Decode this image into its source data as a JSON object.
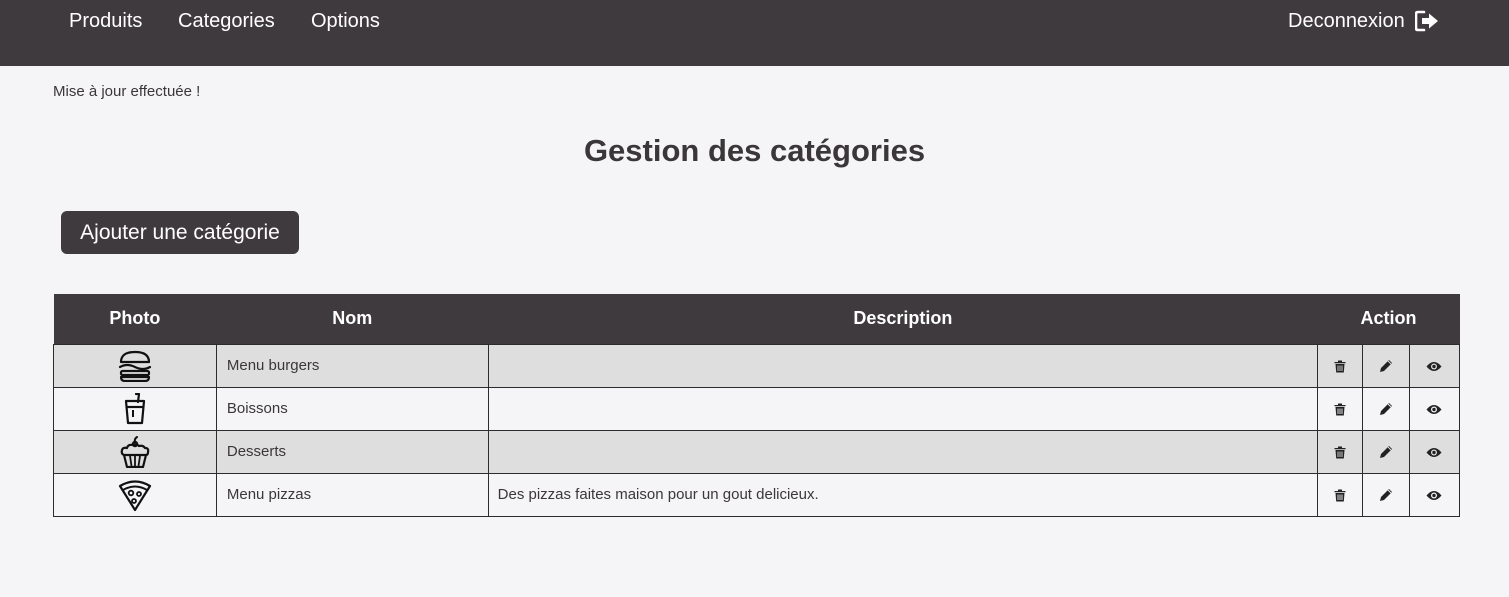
{
  "nav": {
    "items": [
      {
        "label": "Produits"
      },
      {
        "label": "Categories"
      },
      {
        "label": "Options"
      }
    ],
    "logout_label": "Deconnexion"
  },
  "flash_message": "Mise à jour effectuée !",
  "page_title": "Gestion des catégories",
  "add_button_label": "Ajouter une catégorie",
  "table": {
    "headers": {
      "photo": "Photo",
      "nom": "Nom",
      "description": "Description",
      "action": "Action"
    },
    "rows": [
      {
        "icon": "burger-icon",
        "nom": "Menu burgers",
        "description": ""
      },
      {
        "icon": "drink-cup-icon",
        "nom": "Boissons",
        "description": ""
      },
      {
        "icon": "cupcake-icon",
        "nom": "Desserts",
        "description": ""
      },
      {
        "icon": "pizza-slice-icon",
        "nom": "Menu pizzas",
        "description": "Des pizzas faites maison pour un gout delicieux."
      }
    ],
    "action_icons": [
      "trash-icon",
      "pencil-icon",
      "eye-icon"
    ]
  },
  "colors": {
    "navbar": "#3f3a3d",
    "background": "#f5f4f7",
    "row_shade": "#dfdedf",
    "text": "#3b3739"
  }
}
